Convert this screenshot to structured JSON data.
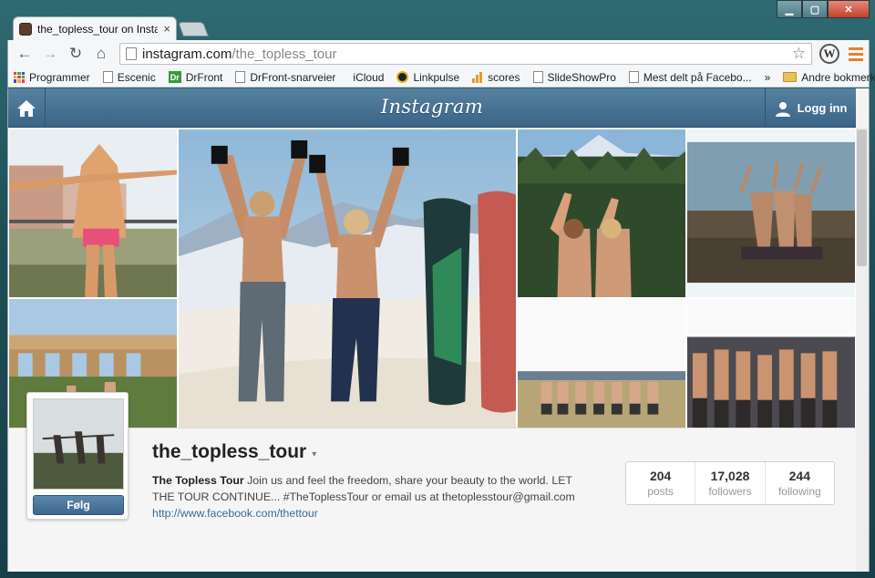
{
  "browser": {
    "tab_title": "the_topless_tour on Instag",
    "tab_close": "×",
    "url_host": "instagram.com",
    "url_path": "/the_topless_tour",
    "bookmarks": [
      "Programmer",
      "Escenic",
      "DrFront",
      "DrFront-snarveier",
      "iCloud",
      "Linkpulse",
      "scores",
      "SlideShowPro",
      "Mest delt på Facebo..."
    ],
    "bookmarks_more": "»",
    "bookmarks_folder": "Andre bokmerker",
    "dr_badge": "Dr"
  },
  "header": {
    "logo": "Instagram",
    "login": "Logg inn"
  },
  "profile": {
    "username": "the_topless_tour",
    "caret": "▾",
    "display_name": "The Topless Tour",
    "bio_text": "Join us and feel the freedom, share your beauty to the world. LET THE TOUR CONTINUE... #TheToplessTour or email us at thetoplesstour@gmail.com",
    "bio_link": "http://www.facebook.com/thettour",
    "follow_label": "Følg",
    "stats": [
      {
        "num": "204",
        "label": "posts"
      },
      {
        "num": "17,028",
        "label": "followers"
      },
      {
        "num": "244",
        "label": "following"
      }
    ]
  },
  "colors": {
    "header_blue": "#3b6487",
    "follow_blue": "#3c6790",
    "link_blue": "#3b6b96"
  }
}
